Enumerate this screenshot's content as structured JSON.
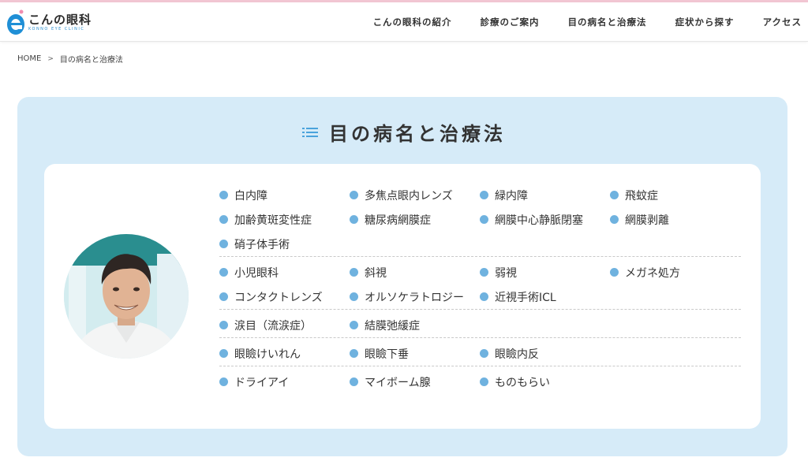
{
  "header": {
    "logo_main": "こんの眼科",
    "logo_sub": "KONNO EYE CLINIC",
    "nav": [
      "こんの眼科の紹介",
      "診療のご案内",
      "目の病名と治療法",
      "症状から探す",
      "アクセス"
    ]
  },
  "breadcrumb": {
    "home": "HOME",
    "separator": ">",
    "current": "目の病名と治療法"
  },
  "section": {
    "title": "目の病名と治療法",
    "title_icon": "list-icon"
  },
  "colors": {
    "panel_bg": "#d6ebf8",
    "dot": "#6fb2df",
    "accent": "#2a8fd0",
    "top_line": "#f2c6d3"
  },
  "diseases": {
    "group1": {
      "row1": [
        "白内障",
        "多焦点眼内レンズ",
        "緑内障",
        "飛蚊症"
      ],
      "row2": [
        "加齢黄斑変性症",
        "糖尿病網膜症",
        "網膜中心静脈閉塞",
        "網膜剥離"
      ],
      "row3": [
        "硝子体手術"
      ]
    },
    "group2": {
      "row1": [
        "小児眼科",
        "斜視",
        "弱視",
        "メガネ処方"
      ],
      "row2": [
        "コンタクトレンズ",
        "オルソケラトロジー",
        "近視手術ICL"
      ]
    },
    "group3": {
      "row1": [
        "涙目（流涙症）",
        "結膜弛緩症"
      ]
    },
    "group4": {
      "row1": [
        "眼瞼けいれん",
        "眼瞼下垂",
        "眼瞼内反"
      ]
    },
    "group5": {
      "row1": [
        "ドライアイ",
        "マイボーム腺",
        "ものもらい"
      ]
    }
  }
}
